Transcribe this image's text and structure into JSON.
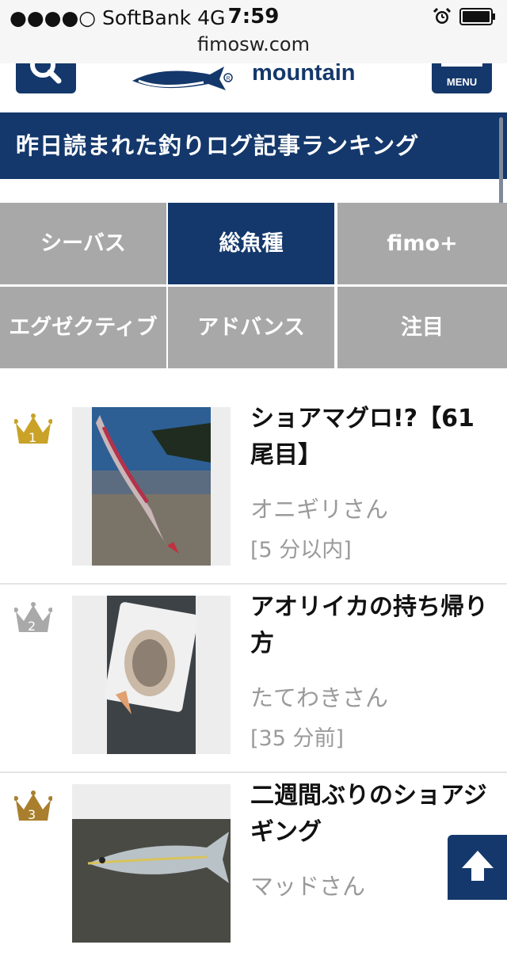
{
  "status_bar": {
    "carrier": "●●●●○ SoftBank   4G",
    "time": "7:59",
    "url": "fimosw.com"
  },
  "header": {
    "logo_text": "mountain",
    "menu_label": "MENU"
  },
  "section": {
    "title": "昨日読まれた釣りログ記事ランキング"
  },
  "tabs": [
    {
      "label": "シーバス",
      "active": false
    },
    {
      "label": "総魚種",
      "active": true
    },
    {
      "label": "fimo+",
      "active": false
    },
    {
      "label": "エグゼクティブ",
      "active": false
    },
    {
      "label": "アドバンス",
      "active": false
    },
    {
      "label": "注目",
      "active": false
    }
  ],
  "ranking": [
    {
      "rank": "1",
      "title": "ショアマグロ!?【61尾目】",
      "author": "オニギリさん",
      "time": "[5 分以内]",
      "crown_color": "#c9a227"
    },
    {
      "rank": "2",
      "title": "アオリイカの持ち帰り方",
      "author": "たてわきさん",
      "time": "[35 分前]",
      "crown_color": "#a9a9a9"
    },
    {
      "rank": "3",
      "title": "二週間ぶりのショアジギング",
      "author": "マッドさん",
      "time": "",
      "crown_color": "#a97f2e"
    }
  ]
}
